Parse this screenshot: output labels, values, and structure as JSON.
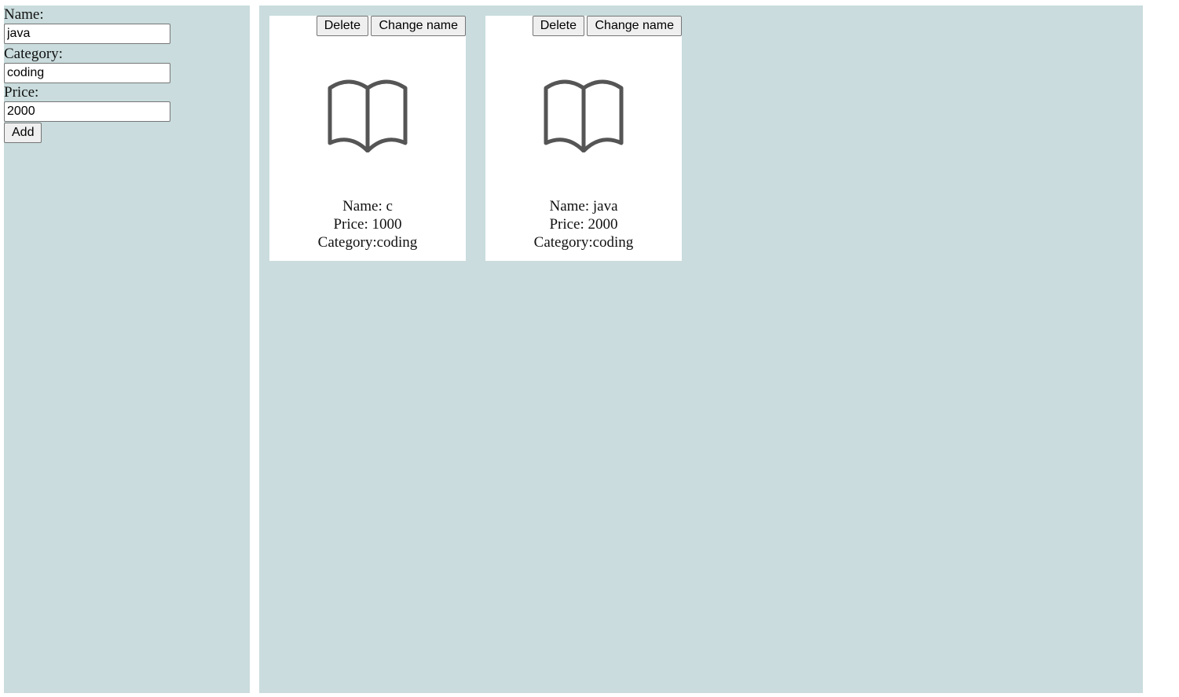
{
  "form": {
    "name_label": "Name:",
    "name_value": "java",
    "category_label": "Category:",
    "category_value": "coding",
    "price_label": "Price:",
    "price_value": "2000",
    "add_label": "Add"
  },
  "cards": [
    {
      "delete_label": "Delete",
      "change_label": "Change name",
      "icon": "book-open-icon",
      "name_line": "Name: c",
      "price_line": "Price: 1000",
      "category_line": "Category:coding"
    },
    {
      "delete_label": "Delete",
      "change_label": "Change name",
      "icon": "book-open-icon",
      "name_line": "Name: java",
      "price_line": "Price: 2000",
      "category_line": "Category:coding"
    }
  ],
  "colors": {
    "panel_background": "#cadcdd",
    "card_background": "#ffffff",
    "icon_stroke": "#555555"
  }
}
